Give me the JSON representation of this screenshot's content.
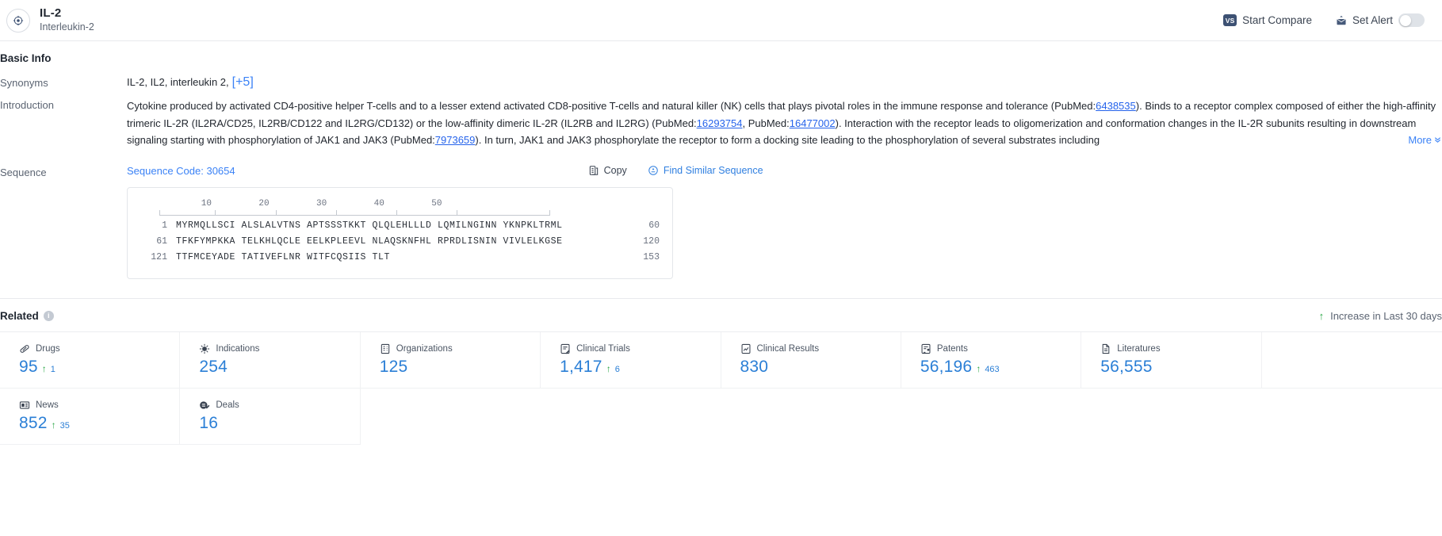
{
  "header": {
    "target_icon": "target-crosshair-icon",
    "title": "IL-2",
    "subtitle": "Interleukin-2",
    "compare_button": {
      "label": "Start Compare",
      "chip": "VS"
    },
    "alert_button": {
      "label": "Set Alert",
      "toggle_state": "off"
    }
  },
  "basic_info": {
    "section_title": "Basic Info",
    "synonyms": {
      "label": "Synonyms",
      "value": "IL-2,  IL2,  interleukin 2,",
      "more": "[+5]"
    },
    "introduction": {
      "label": "Introduction",
      "more_label": "More",
      "parts": [
        {
          "t": "Cytokine produced by activated CD4-positive helper T-cells and to a lesser extend activated CD8-positive T-cells and natural killer (NK) cells that plays pivotal roles in the immune response and tolerance (PubMed:"
        },
        {
          "link": "6438535"
        },
        {
          "t": "). Binds to a receptor complex composed of either the high-affinity trimeric IL-2R (IL2RA/CD25, IL2RB/CD122 and IL2RG/CD132) or the low-affinity dimeric IL-2R (IL2RB and IL2RG) (PubMed:"
        },
        {
          "link": "16293754"
        },
        {
          "t": ", PubMed:"
        },
        {
          "link": "16477002"
        },
        {
          "t": "). Interaction with the receptor leads to oligomerization and conformation changes in the IL-2R subunits resulting in downstream signaling starting with phosphorylation of JAK1 and JAK3 (PubMed:"
        },
        {
          "link": "7973659"
        },
        {
          "t": "). In turn, JAK1 and JAK3 phosphorylate the receptor to form a docking site leading to the phosphorylation of several substrates including"
        }
      ]
    },
    "sequence": {
      "label": "Sequence",
      "code_label": "Sequence Code: 30654",
      "copy_label": "Copy",
      "find_similar_label": "Find Similar Sequence",
      "ruler_ticks": [
        "10",
        "20",
        "30",
        "40",
        "50"
      ],
      "lines": [
        {
          "start": "1",
          "blocks": "MYRMQLLSCI ALSLALVTNS APTSSSTKKT QLQLEHLLLD LQMILNGINN YKNPKLTRML",
          "end": "60"
        },
        {
          "start": "61",
          "blocks": "TFKFYMPKKA TELKHLQCLE EELKPLEEVL NLAQSKNFHL RPRDLISNIN VIVLELKGSE",
          "end": "120"
        },
        {
          "start": "121",
          "blocks": "TTFMCEYADE TATIVEFLNR WITFCQSIIS TLT",
          "end": "153"
        }
      ]
    }
  },
  "related": {
    "title": "Related",
    "info_glyph": "i",
    "increase_note": "Increase in Last 30 days",
    "up_glyph": "↑",
    "stats": [
      {
        "icon": "pill-icon",
        "label": "Drugs",
        "value": "95",
        "delta": "1"
      },
      {
        "icon": "virus-icon",
        "label": "Indications",
        "value": "254",
        "delta": ""
      },
      {
        "icon": "building-icon",
        "label": "Organizations",
        "value": "125",
        "delta": ""
      },
      {
        "icon": "clinical-trial-icon",
        "label": "Clinical Trials",
        "value": "1,417",
        "delta": "6"
      },
      {
        "icon": "clinical-result-icon",
        "label": "Clinical Results",
        "value": "830",
        "delta": ""
      },
      {
        "icon": "patent-icon",
        "label": "Patents",
        "value": "56,196",
        "delta": "463"
      },
      {
        "icon": "literature-icon",
        "label": "Literatures",
        "value": "56,555",
        "delta": ""
      },
      {
        "icon": "blank",
        "label": "",
        "value": "",
        "delta": ""
      },
      {
        "icon": "news-icon",
        "label": "News",
        "value": "852",
        "delta": "35"
      },
      {
        "icon": "deals-icon",
        "label": "Deals",
        "value": "16",
        "delta": ""
      }
    ]
  },
  "colors": {
    "accent_blue": "#2b7fd6",
    "link_blue": "#2563eb",
    "increase_green": "#2aa745",
    "dark_navy": "#3d5173"
  }
}
